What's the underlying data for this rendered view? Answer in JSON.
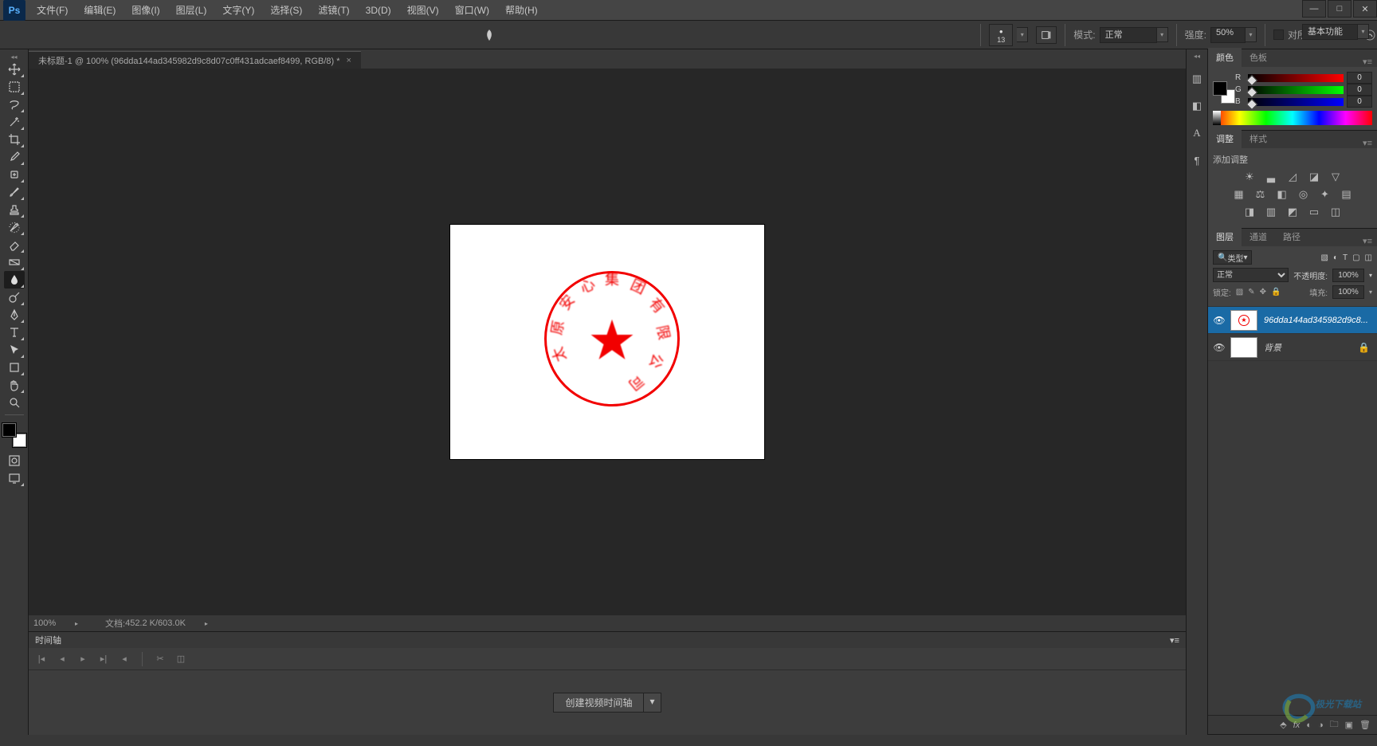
{
  "menubar": {
    "items": [
      "文件(F)",
      "编辑(E)",
      "图像(I)",
      "图层(L)",
      "文字(Y)",
      "选择(S)",
      "滤镜(T)",
      "3D(D)",
      "视图(V)",
      "窗口(W)",
      "帮助(H)"
    ]
  },
  "optbar": {
    "brush_size": "13",
    "mode_label": "模式:",
    "mode_value": "正常",
    "strength_label": "强度:",
    "strength_value": "50%",
    "sample_all_label": "对所有图层取样"
  },
  "workspace": "基本功能",
  "doc_tab": "未标题-1 @ 100% (96dda144ad345982d9c8d07c0ff431adcaef8499, RGB/8) *",
  "zoom": "100%",
  "docinfo_label": "文档:",
  "docinfo_value": "452.2 K/603.0K",
  "timeline": {
    "title": "时间轴",
    "create_btn": "创建视频时间轴"
  },
  "color": {
    "tab1": "颜色",
    "tab2": "色板",
    "r_label": "R",
    "g_label": "G",
    "b_label": "B",
    "r": "0",
    "g": "0",
    "b": "0"
  },
  "adjust": {
    "tab1": "调整",
    "tab2": "样式",
    "add_label": "添加调整"
  },
  "layers": {
    "tab1": "图层",
    "tab2": "通道",
    "tab3": "路径",
    "filter": "类型",
    "blend": "正常",
    "opacity_label": "不透明度:",
    "opacity": "100%",
    "lock_label": "锁定:",
    "fill_label": "填充:",
    "fill": "100%",
    "items": [
      {
        "name": "96dda144ad345982d9c8...",
        "selected": true,
        "locked": false
      },
      {
        "name": "背景",
        "selected": false,
        "locked": true
      }
    ]
  },
  "stamp": {
    "chars": [
      "集",
      "团",
      "有",
      "限",
      "公",
      "司",
      "原",
      "安",
      "心",
      "太"
    ]
  }
}
